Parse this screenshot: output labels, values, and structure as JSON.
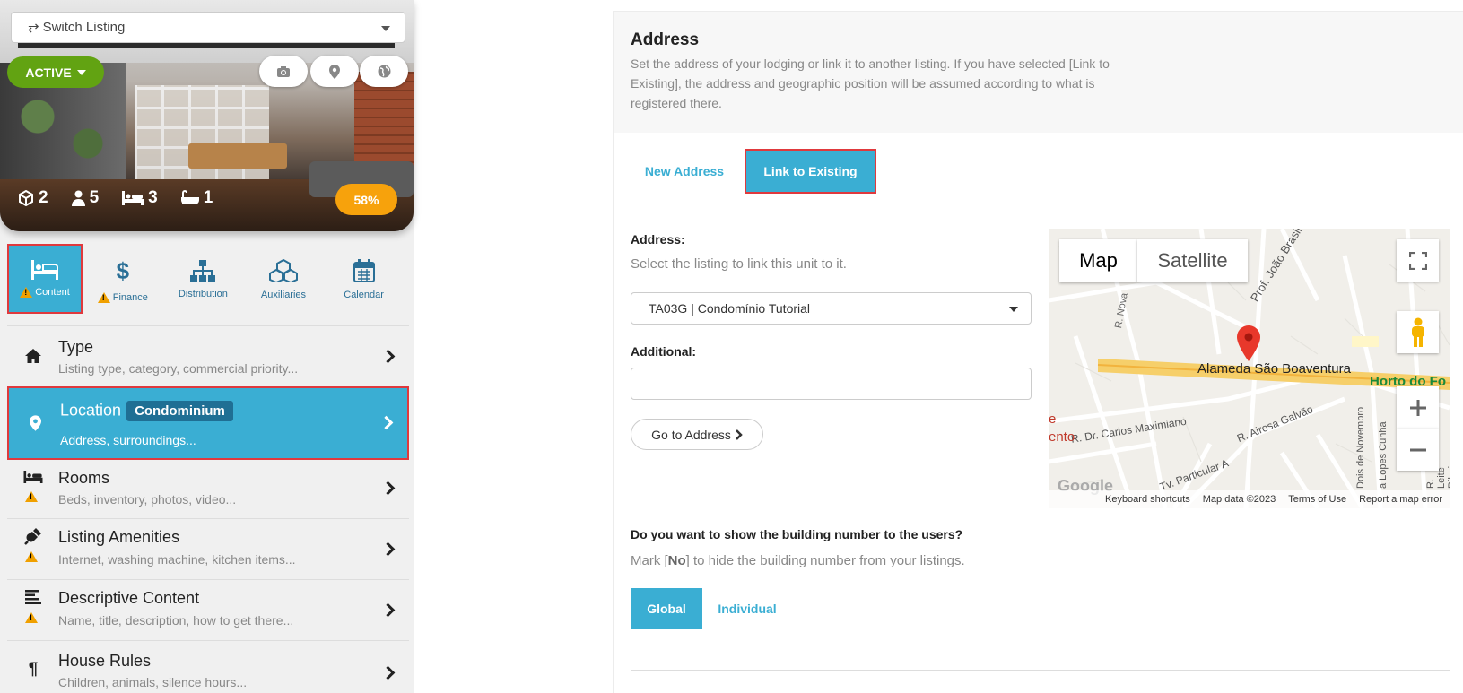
{
  "listing": {
    "switch_label": "Switch Listing",
    "status": "ACTIVE",
    "stats": {
      "units": "2",
      "guests": "5",
      "beds": "3",
      "baths": "1"
    },
    "completion": "58%"
  },
  "tabs": [
    {
      "label": "Content",
      "warning": true
    },
    {
      "label": "Finance",
      "warning": true
    },
    {
      "label": "Distribution",
      "warning": false
    },
    {
      "label": "Auxiliaries",
      "warning": false
    },
    {
      "label": "Calendar",
      "warning": false
    }
  ],
  "menu": {
    "type": {
      "title": "Type",
      "sub": "Listing type, category, commercial priority..."
    },
    "location": {
      "title": "Location",
      "badge": "Condominium",
      "sub": "Address, surroundings..."
    },
    "rooms": {
      "title": "Rooms",
      "sub": "Beds, inventory, photos, video..."
    },
    "amenities": {
      "title": "Listing Amenities",
      "sub": "Internet, washing machine, kitchen items..."
    },
    "descriptive": {
      "title": "Descriptive Content",
      "sub": "Name, title, description, how to get there..."
    },
    "rules": {
      "title": "House Rules",
      "sub": "Children, animals, silence hours..."
    }
  },
  "address": {
    "title": "Address",
    "description": "Set the address of your lodging or link it to another listing. If you have selected [Link to Existing], the address and geographic position will be assumed according to what is registered there.",
    "tab_new": "New Address",
    "tab_link": "Link to Existing",
    "address_label": "Address:",
    "address_help": "Select the listing to link this unit to it.",
    "selected_listing": "TA03G | Condomínio Tutorial",
    "additional_label": "Additional:",
    "additional_value": "",
    "goto_label": "Go to Address",
    "question": "Do you want to show the building number to the users?",
    "help_pre": "Mark [",
    "help_no": "No",
    "help_post": "] to hide the building number from your listings.",
    "btn_global": "Global",
    "btn_individual": "Individual"
  },
  "map": {
    "btn_map": "Map",
    "btn_satellite": "Satellite",
    "street_main": "Alameda São Boaventura",
    "street_horto": "Horto do Fo",
    "street_joao": "Prof. João Brasil",
    "street_nova": "R. Nova",
    "street_carlos": "R. Dr. Carlos Maximiano",
    "street_airosa": "R. Airosa Galvão",
    "street_particular": "Tv. Particular A",
    "street_novembro": "Dois de Novembro",
    "street_lopes": "a Lopes Cunha",
    "street_leite": "R. Leite Ribeiro",
    "label_ento": "ento",
    "label_e": "e",
    "google": "Google",
    "footer": {
      "keyboard": "Keyboard shortcuts",
      "data": "Map data ©2023",
      "terms": "Terms of Use",
      "report": "Report a map error"
    }
  }
}
